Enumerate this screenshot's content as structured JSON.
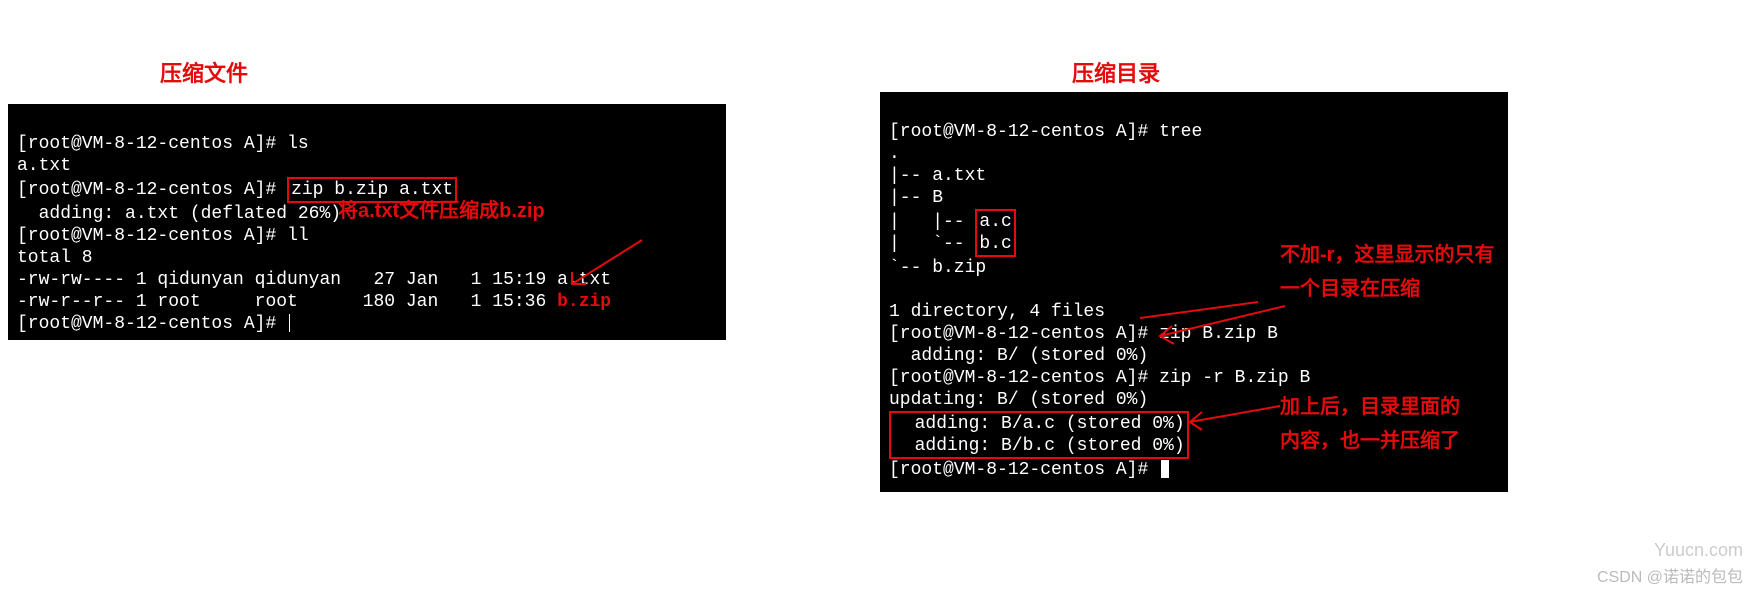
{
  "left": {
    "title": "压缩文件",
    "prompt": "[root@VM-8-12-centos A]#",
    "ls_cmd": "ls",
    "ls_out": "a.txt",
    "zip_cmd": "zip b.zip a.txt",
    "zip_out": "  adding: a.txt (deflated 26%)",
    "ll_cmd": "ll",
    "ll_total": "total 8",
    "ll_line1": "-rw-rw---- 1 qidunyan qidunyan   27 Jan   1 15:19 a.txt",
    "ll_line2_pre": "-rw-r--r-- 1 root     root      180 Jan   1 15:36 ",
    "ll_line2_file": "b.zip",
    "annot": "将a.txt文件压缩成b.zip"
  },
  "right": {
    "title": "压缩目录",
    "prompt": "[root@VM-8-12-centos A]#",
    "tree_cmd": "tree",
    "tree_dot": ".",
    "tree_l1": "|-- a.txt",
    "tree_l2": "|-- B",
    "tree_l3_pre": "|   |-- ",
    "tree_l3_box": "a.c",
    "tree_l4_pre": "|   `-- ",
    "tree_l4_box": "b.c",
    "tree_l5": "`-- b.zip",
    "tree_sum": "1 directory, 4 files",
    "zip1_cmd": "zip B.zip B",
    "zip1_out": "  adding: B/ (stored 0%)",
    "zip2_cmd": "zip -r B.zip B",
    "zip2_out1": "updating: B/ (stored 0%)",
    "box_a": "  adding: B/a.c (stored 0%)",
    "box_b": "  adding: B/b.c (stored 0%)",
    "annot1a": "不加-r，这里显示的只有",
    "annot1b": "一个目录在压缩",
    "annot2a": "加上后，目录里面的",
    "annot2b": "内容，也一并压缩了"
  },
  "wm1": "Yuucn.com",
  "wm2": "CSDN @诺诺的包包"
}
